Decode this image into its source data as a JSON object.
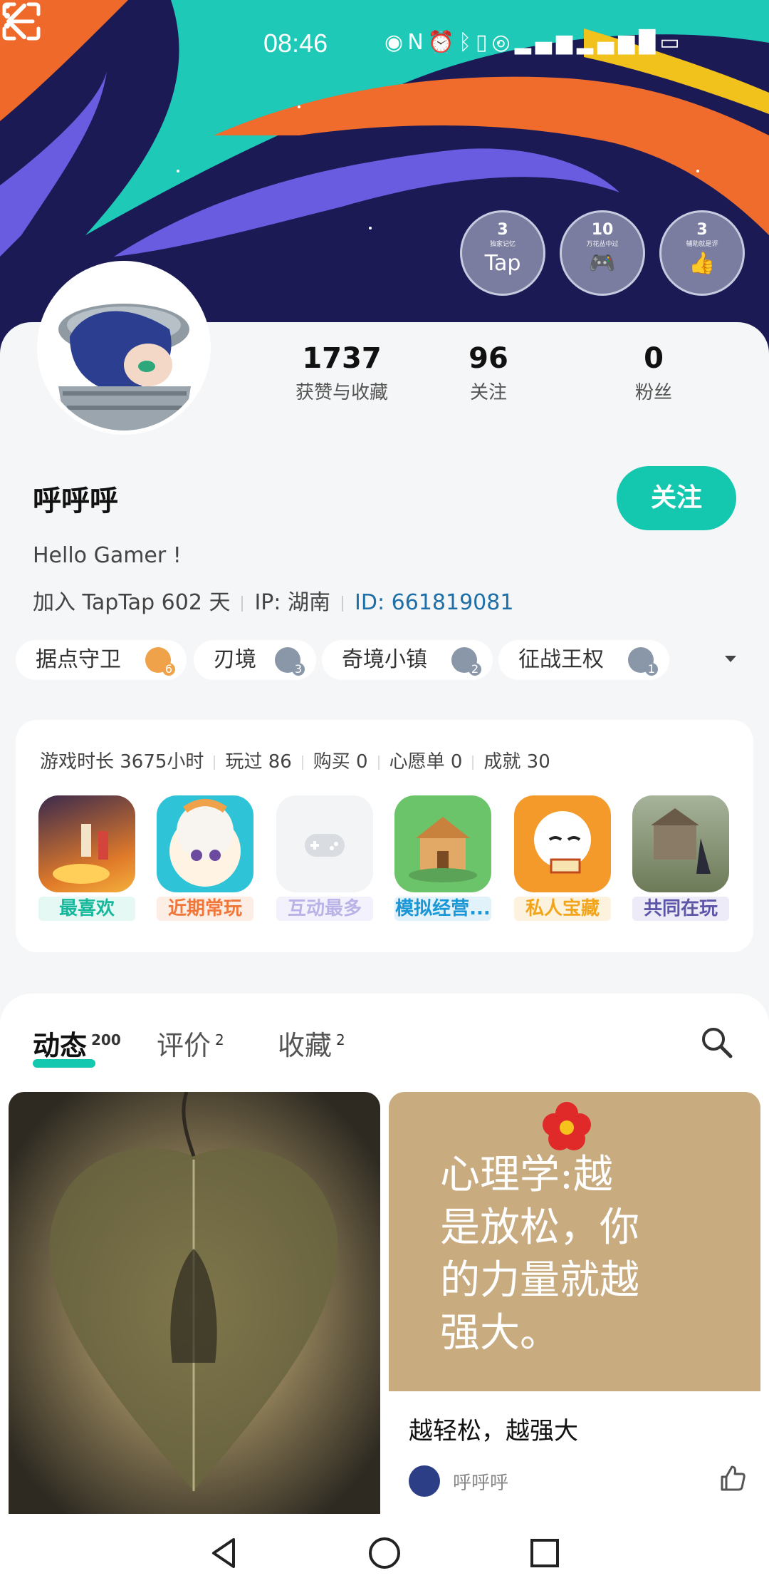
{
  "status_bar": {
    "time": "08:46",
    "icons": [
      "eye-icon",
      "nfc-icon",
      "alarm-icon",
      "bluetooth-icon",
      "vibrate-icon",
      "hotspot-icon",
      "signal-4g-icon",
      "signal-5g-icon",
      "battery-icon"
    ]
  },
  "header": {
    "badges": [
      {
        "count": "3",
        "caption": "独家记忆",
        "icon": "tap-icon"
      },
      {
        "count": "10",
        "caption": "万花丛中过",
        "icon": "gamepad-icon"
      },
      {
        "count": "3",
        "caption": "辅助就是评",
        "icon": "thumbs-up-icon"
      }
    ]
  },
  "profile": {
    "stats": [
      {
        "value": "1737",
        "label": "获赞与收藏"
      },
      {
        "value": "96",
        "label": "关注"
      },
      {
        "value": "0",
        "label": "粉丝"
      }
    ],
    "name": "呼呼呼",
    "follow_label": "关注",
    "bio": "Hello Gamer !",
    "joined": "加入 TapTap 602 天",
    "ip_label": "IP:",
    "ip_value": "湖南",
    "id_label": "ID:",
    "id_value": "661819081"
  },
  "game_tags": [
    {
      "name": "据点守卫",
      "level": "6",
      "color": "#f0a24a"
    },
    {
      "name": "刃境",
      "level": "3",
      "color": "#8a97a8"
    },
    {
      "name": "奇境小镇",
      "level": "2",
      "color": "#8a97a8"
    },
    {
      "name": "征战王权",
      "level": "1",
      "color": "#8a97a8"
    }
  ],
  "game_stats": {
    "playtime": "游戏时长 3675小时",
    "played": "玩过 86",
    "bought": "购买 0",
    "wishlist": "心愿单 0",
    "achievements": "成就 30"
  },
  "game_categories": [
    {
      "label": "最喜欢",
      "color": "#16b89c",
      "bg": "#e6f8f4"
    },
    {
      "label": "近期常玩",
      "color": "#f0763a",
      "bg": "#fdeee5"
    },
    {
      "label": "互动最多",
      "color": "#b9b3e8",
      "bg": "#f3f2fc"
    },
    {
      "label": "模拟经营...",
      "color": "#1a97d6",
      "bg": "#e2f2fb"
    },
    {
      "label": "私人宝藏",
      "color": "#f2a51a",
      "bg": "#fdf2dd"
    },
    {
      "label": "共同在玩",
      "color": "#5d55a8",
      "bg": "#ecebf7"
    }
  ],
  "feed_tabs": [
    {
      "label": "动态",
      "count": "200"
    },
    {
      "label": "评价",
      "count": "2"
    },
    {
      "label": "收藏",
      "count": "2"
    }
  ],
  "posts": [
    {
      "quote_lines": [
        "心理学:越",
        "是放松，你",
        "的力量就越",
        "强大。"
      ],
      "title": "越轻松，越强大",
      "author": "呼呼呼"
    }
  ]
}
